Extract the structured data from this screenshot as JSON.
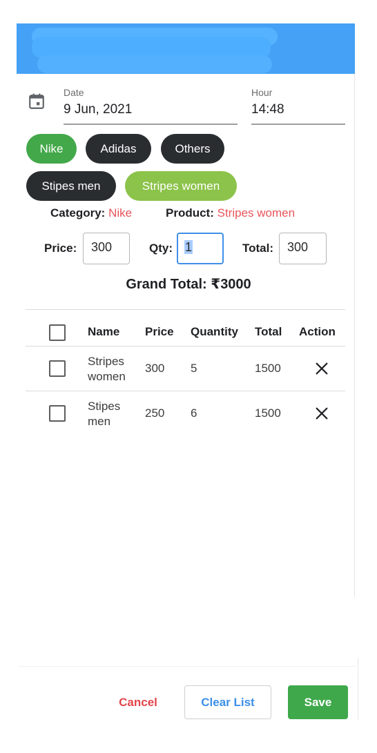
{
  "header": {
    "title_visible": false
  },
  "date_field": {
    "label": "Date",
    "value": "9 Jun, 2021"
  },
  "hour_field": {
    "label": "Hour",
    "value": "14:48"
  },
  "category_chips": [
    {
      "label": "Nike",
      "selected": true
    },
    {
      "label": "Adidas",
      "selected": false
    },
    {
      "label": "Others",
      "selected": false
    }
  ],
  "product_chips": [
    {
      "label": "Stipes men",
      "selected": false
    },
    {
      "label": "Stripes women",
      "selected": true
    }
  ],
  "selection": {
    "category_label": "Category:",
    "category_value": "Nike",
    "product_label": "Product:",
    "product_value": "Stripes women"
  },
  "entry": {
    "price_label": "Price:",
    "price_value": "300",
    "qty_label": "Qty:",
    "qty_value": "1",
    "total_label": "Total:",
    "total_value": "300"
  },
  "grand_total": "Grand Total: ₹3000",
  "table": {
    "headers": [
      "Name",
      "Price",
      "Quantity",
      "Total",
      "Action"
    ],
    "rows": [
      {
        "name": "Stripes women",
        "price": "300",
        "quantity": "5",
        "total": "1500",
        "checked": false
      },
      {
        "name": "Stipes men",
        "price": "250",
        "quantity": "6",
        "total": "1500",
        "checked": false
      }
    ]
  },
  "actions": {
    "cancel": "Cancel",
    "clear": "Clear List",
    "save": "Save"
  },
  "colors": {
    "app_bar": "#45a1f5",
    "chip_selected": "#43a84a",
    "chip_default": "#2a2d30",
    "chip_product_selected": "#8cc34a",
    "accent_red": "#e8545a",
    "save_green": "#3fa84b",
    "link_blue": "#3b8fe8"
  }
}
